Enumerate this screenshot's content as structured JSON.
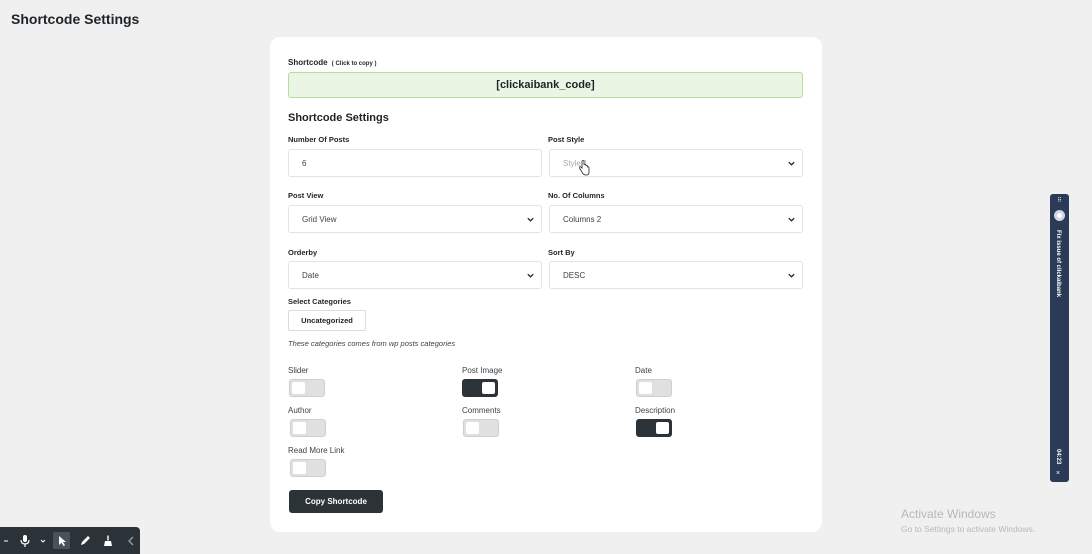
{
  "page": {
    "title": "Shortcode Settings"
  },
  "shortcode": {
    "label": "Shortcode",
    "hint": "( Click to copy )",
    "value": "[clickaibank_code]"
  },
  "settings": {
    "title": "Shortcode Settings",
    "number_of_posts": {
      "label": "Number Of Posts",
      "value": "6"
    },
    "post_style": {
      "label": "Post Style",
      "value": "Style 1"
    },
    "post_view": {
      "label": "Post View",
      "value": "Grid View"
    },
    "columns": {
      "label": "No. Of Columns",
      "value": "Columns 2"
    },
    "orderby": {
      "label": "Orderby",
      "value": "Date"
    },
    "sort_by": {
      "label": "Sort By",
      "value": "DESC"
    }
  },
  "categories": {
    "label": "Select Categories",
    "selected": "Uncategorized",
    "note": "These categories comes from wp posts categories"
  },
  "toggles": {
    "slider": {
      "label": "Slider",
      "on": false
    },
    "post_image": {
      "label": "Post Image",
      "on": true
    },
    "date": {
      "label": "Date",
      "on": false
    },
    "author": {
      "label": "Author",
      "on": false
    },
    "comments": {
      "label": "Comments",
      "on": false
    },
    "description": {
      "label": "Description",
      "on": true
    },
    "read_more_link": {
      "label": "Read More Link",
      "on": false
    }
  },
  "copy_button": {
    "label": "Copy Shortcode"
  },
  "recorder": {
    "title": "Fix issue of clickaibank",
    "time": "04:23",
    "close": "×",
    "grip": "⠿",
    "icons": [
      "drag-handle-icon",
      "record-icon",
      "close-icon"
    ]
  },
  "watermark": {
    "line1": "Activate Windows",
    "line2": "Go to Settings to activate Windows."
  },
  "toolbar": {
    "icons": [
      "mic-icon",
      "pointer-icon",
      "pen-icon",
      "broom-icon",
      "chevron-left-icon"
    ]
  },
  "colors": {
    "background": "#f0f0f1",
    "card": "#ffffff",
    "shortcode_bg": "#eaf6e3",
    "shortcode_border": "#b6dc9f",
    "toggle_on": "#2c3338",
    "toggle_off": "#e0e0e0",
    "button": "#2c3338",
    "recorder_panel": "#2b3a57"
  }
}
